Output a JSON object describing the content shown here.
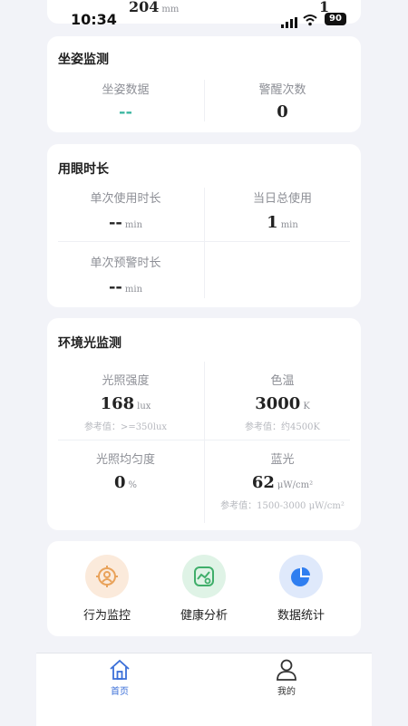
{
  "status_bar": {
    "time": "10:34",
    "battery": "90"
  },
  "top_partial": {
    "left_value": "204",
    "left_unit": "mm",
    "right_value": "1"
  },
  "posture": {
    "title": "坐姿监测",
    "items": [
      {
        "label": "坐姿数据",
        "value": "--"
      },
      {
        "label": "警醒次数",
        "value": "0"
      }
    ]
  },
  "eye_use": {
    "title": "用眼时长",
    "items": [
      {
        "label": "单次使用时长",
        "value": "--",
        "unit": "min"
      },
      {
        "label": "当日总使用",
        "value": "1",
        "unit": "min"
      },
      {
        "label": "单次预警时长",
        "value": "--",
        "unit": "min"
      }
    ]
  },
  "ambient": {
    "title": "环境光监测",
    "items": [
      {
        "label": "光照强度",
        "value": "168",
        "unit": "lux",
        "ref": "参考值：>=350lux"
      },
      {
        "label": "色温",
        "value": "3000",
        "unit": "K",
        "ref": "参考值：约4500K"
      },
      {
        "label": "光照均匀度",
        "value": "0",
        "unit": "%"
      },
      {
        "label": "蓝光",
        "value": "62",
        "unit": "μW/cm²",
        "ref": "参考值：1500-3000 μW/cm²"
      }
    ]
  },
  "quick_actions": [
    {
      "label": "行为监控",
      "icon": "behavior-monitor-icon",
      "color": "#e9a25a"
    },
    {
      "label": "健康分析",
      "icon": "health-analysis-icon",
      "color": "#3fae6a"
    },
    {
      "label": "数据统计",
      "icon": "data-statistics-icon",
      "color": "#2f7ef0"
    }
  ],
  "tabbar": {
    "items": [
      {
        "label": "首页",
        "icon": "home-icon",
        "active": true
      },
      {
        "label": "我的",
        "icon": "profile-icon",
        "active": false
      }
    ],
    "active_color": "#3b6fd8"
  }
}
